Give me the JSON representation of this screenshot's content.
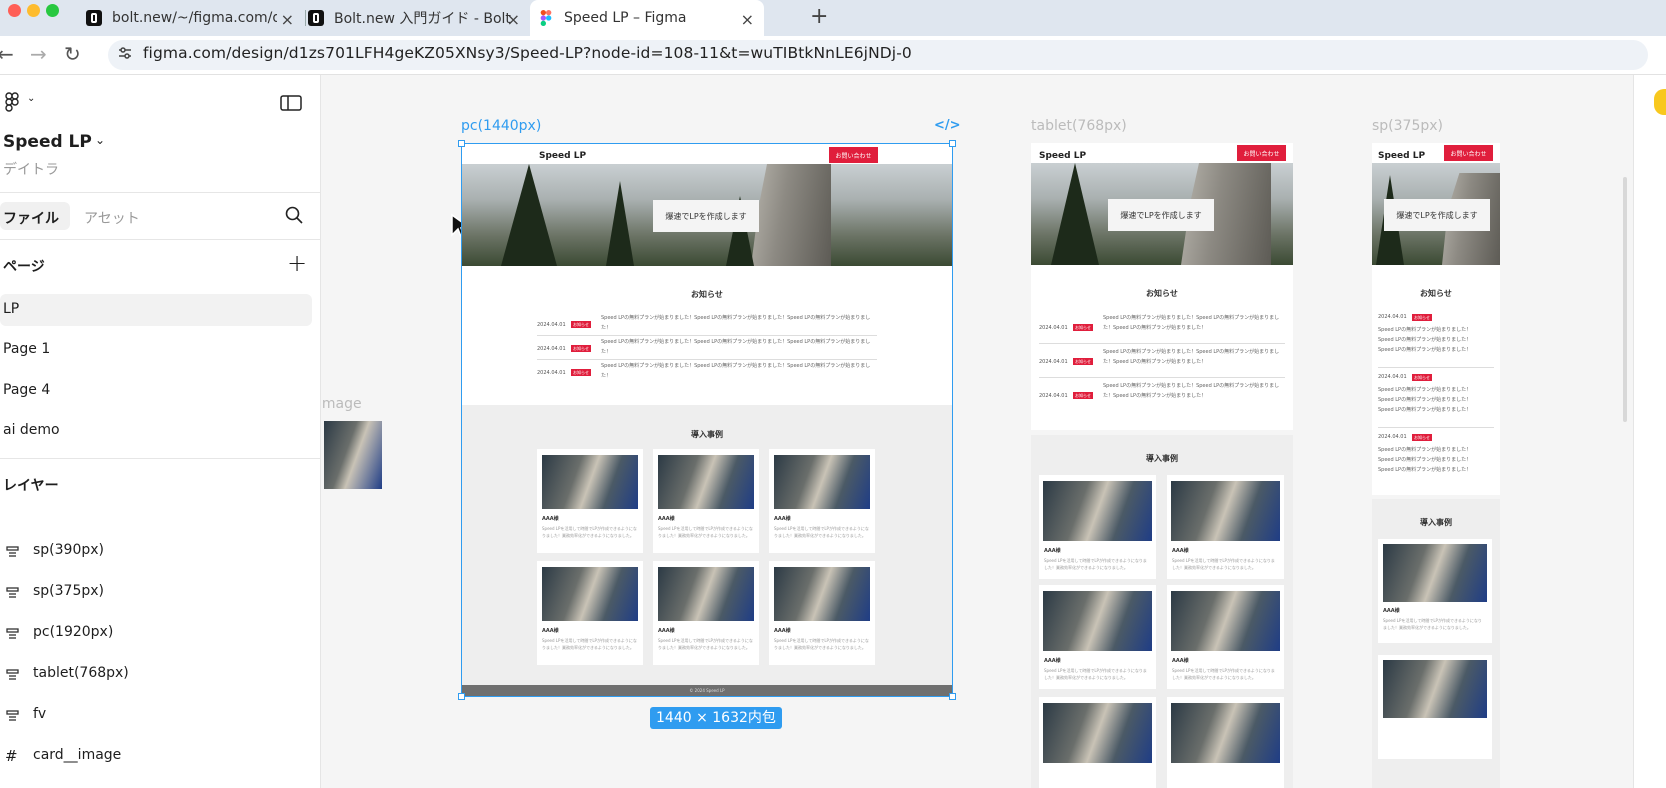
{
  "browser": {
    "tabs": [
      {
        "title": "bolt.new/~/figma.com/design"
      },
      {
        "title": "Bolt.new 入門ガイド - Bolt"
      },
      {
        "title": "Speed LP – Figma"
      }
    ],
    "new_tab": "+",
    "url": "figma.com/design/d1zs701LFH4geKZ05XNsy3/Speed-LP?node-id=108-11&t=wuTIBtkNnLE6jNDj-0"
  },
  "sidebar": {
    "file_name": "Speed LP",
    "team_name": "デイトラ",
    "tab_file": "ファイル",
    "tab_assets": "アセット",
    "pages_header": "ページ",
    "pages": [
      "LP",
      "Page 1",
      "Page 4",
      "ai demo"
    ],
    "layers_header": "レイヤー",
    "layers": [
      "sp(390px)",
      "sp(375px)",
      "pc(1920px)",
      "tablet(768px)",
      "fv",
      "card__image"
    ]
  },
  "canvas": {
    "image_label": "image",
    "frames": {
      "pc_label": "pc(1440px)",
      "tablet_label": "tablet(768px)",
      "sp_label": "sp(375px)"
    },
    "selection_size": "1440 × 1632内包",
    "code_icon": "</>"
  },
  "design": {
    "logo": "Speed LP",
    "contact_button": "お問い合わせ",
    "hero_text": "爆速でLPを作成します",
    "news_title": "お知らせ",
    "news_date": "2024.04.01",
    "news_badge": "お知らせ",
    "news_text_1": "Speed LPの無料プランが始まりました！Speed LPの無料プランが始まりました！Speed LPの無料プランが始まりました！",
    "news_text_2": "Speed LPの無料プランが始まりました！",
    "cases_title": "導入事例",
    "case_name": "AAA様",
    "case_text_1": "Speed LPを活用して時間でLPが作成できるようになりました！業務効率化ができるようになりました。",
    "footer": "© 2024 Speed LP"
  },
  "colors": {
    "accent_red": "#e01e3c",
    "selection_blue": "#2f9cf0"
  }
}
